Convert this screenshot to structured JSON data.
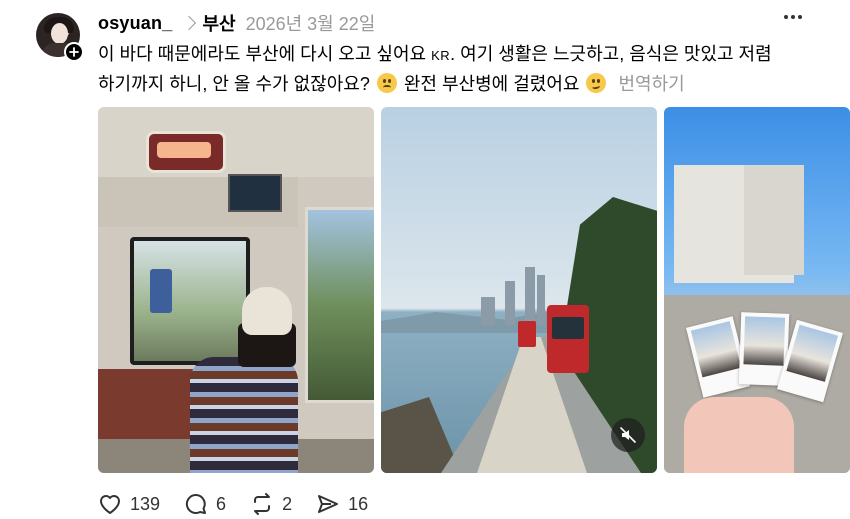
{
  "post": {
    "username": "osyuan_",
    "topic": "부산",
    "date": "2026년 3월 22일",
    "caption_line1": "이 바다 때문에라도 부산에 다시 오고 싶어요 ",
    "caption_kr": "KR",
    "caption_line1b": ". 여기 생활은 느긋하고, 음식은 맛있고 저렴",
    "caption_line2a": "하기까지 하니, 안 올 수가 없잖아요? ",
    "caption_line2b": " 완전 부산병에 걸렸어요 ",
    "translate_label": "번역하기",
    "icons": {
      "more": "more-horizontal-icon",
      "follow": "plus-icon",
      "topic_separator": "chevron-right-icon",
      "emoji1": "sad-face-emoji",
      "emoji2": "woozy-face-emoji",
      "mute": "speaker-muted-icon"
    }
  },
  "actions": {
    "likes": "139",
    "replies": "6",
    "reposts": "2",
    "shares": "16",
    "icons": [
      "heart-icon",
      "comment-icon",
      "repost-icon",
      "send-icon"
    ]
  },
  "photo3": {
    "polaroid_text": ""
  }
}
